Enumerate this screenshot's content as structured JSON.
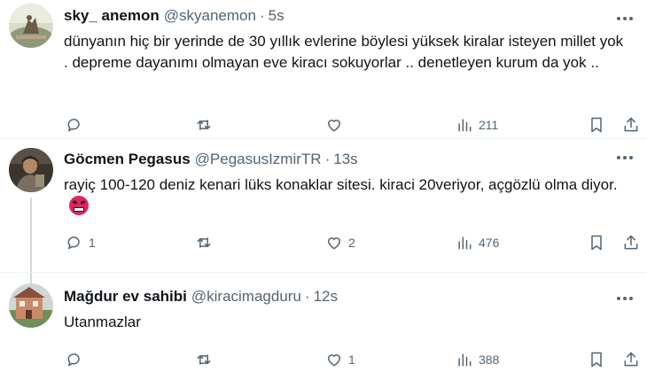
{
  "tweets": [
    {
      "name": "sky_ anemon",
      "handle": "@skyanemon",
      "separator": "·",
      "time": "5s",
      "text": "dünyanın hiç bir yerinde de 30 yıllık evlerine  böylesi yüksek kiralar isteyen millet yok . depreme dayanımı olmayan eve kiracı sokuyorlar .. denetleyen kurum da yok ..",
      "replies": "",
      "retweets": "",
      "likes": "",
      "views": "211",
      "avatar_icon": "avatar-photo-statue"
    },
    {
      "name": "Göcmen Pegasus",
      "handle": "@PegasusIzmirTR",
      "separator": "·",
      "time": "13s",
      "text": "rayiç 100-120 deniz kenari lüks konaklar sitesi. kiraci 20veriyor, açgözlü olma diyor.",
      "emoji": "angry-cursing-face-emoji",
      "replies": "1",
      "retweets": "",
      "likes": "2",
      "views": "476",
      "avatar_icon": "avatar-photo-person"
    },
    {
      "name": "Mağdur ev sahibi",
      "handle": "@kiracimagduru",
      "separator": "·",
      "time": "12s",
      "text": "Utanmazlar",
      "replies": "",
      "retweets": "",
      "likes": "1",
      "views": "388",
      "avatar_icon": "avatar-photo-building"
    }
  ],
  "icons": {
    "reply": "reply-icon",
    "retweet": "retweet-icon",
    "like": "heart-icon",
    "views": "views-chart-icon",
    "bookmark": "bookmark-icon",
    "share": "share-icon",
    "more": "more-dots-icon"
  },
  "colors": {
    "text": "#0f1419",
    "secondary": "#536471",
    "divider": "#eff3f4",
    "thread_line": "#cfd9de"
  }
}
